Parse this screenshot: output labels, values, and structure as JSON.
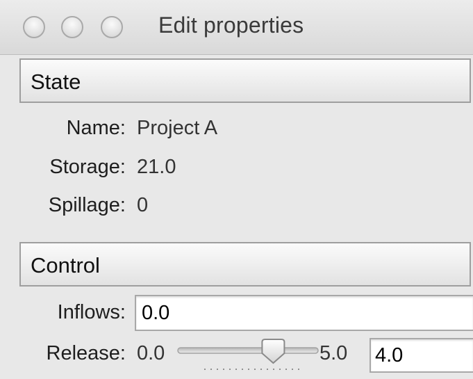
{
  "window": {
    "title": "Edit properties",
    "controls": [
      "close-icon",
      "minimize-icon",
      "zoom-icon"
    ]
  },
  "state": {
    "header": "State",
    "name_label": "Name:",
    "name_value": "Project A",
    "storage_label": "Storage:",
    "storage_value": "21.0",
    "spillage_label": "Spillage:",
    "spillage_value": "0"
  },
  "control": {
    "header": "Control",
    "inflows_label": "Inflows:",
    "inflows_value": "0.0",
    "release_label": "Release:",
    "release_min": "0.0",
    "release_max": "5.0",
    "release_value": "4.0",
    "release_slider_value": 3.5,
    "release_slider_range": [
      0.0,
      5.0
    ]
  },
  "colors": {
    "window_bg": "#e8e8e8",
    "section_border": "#9e9e9e",
    "input_bg": "#ffffff"
  }
}
